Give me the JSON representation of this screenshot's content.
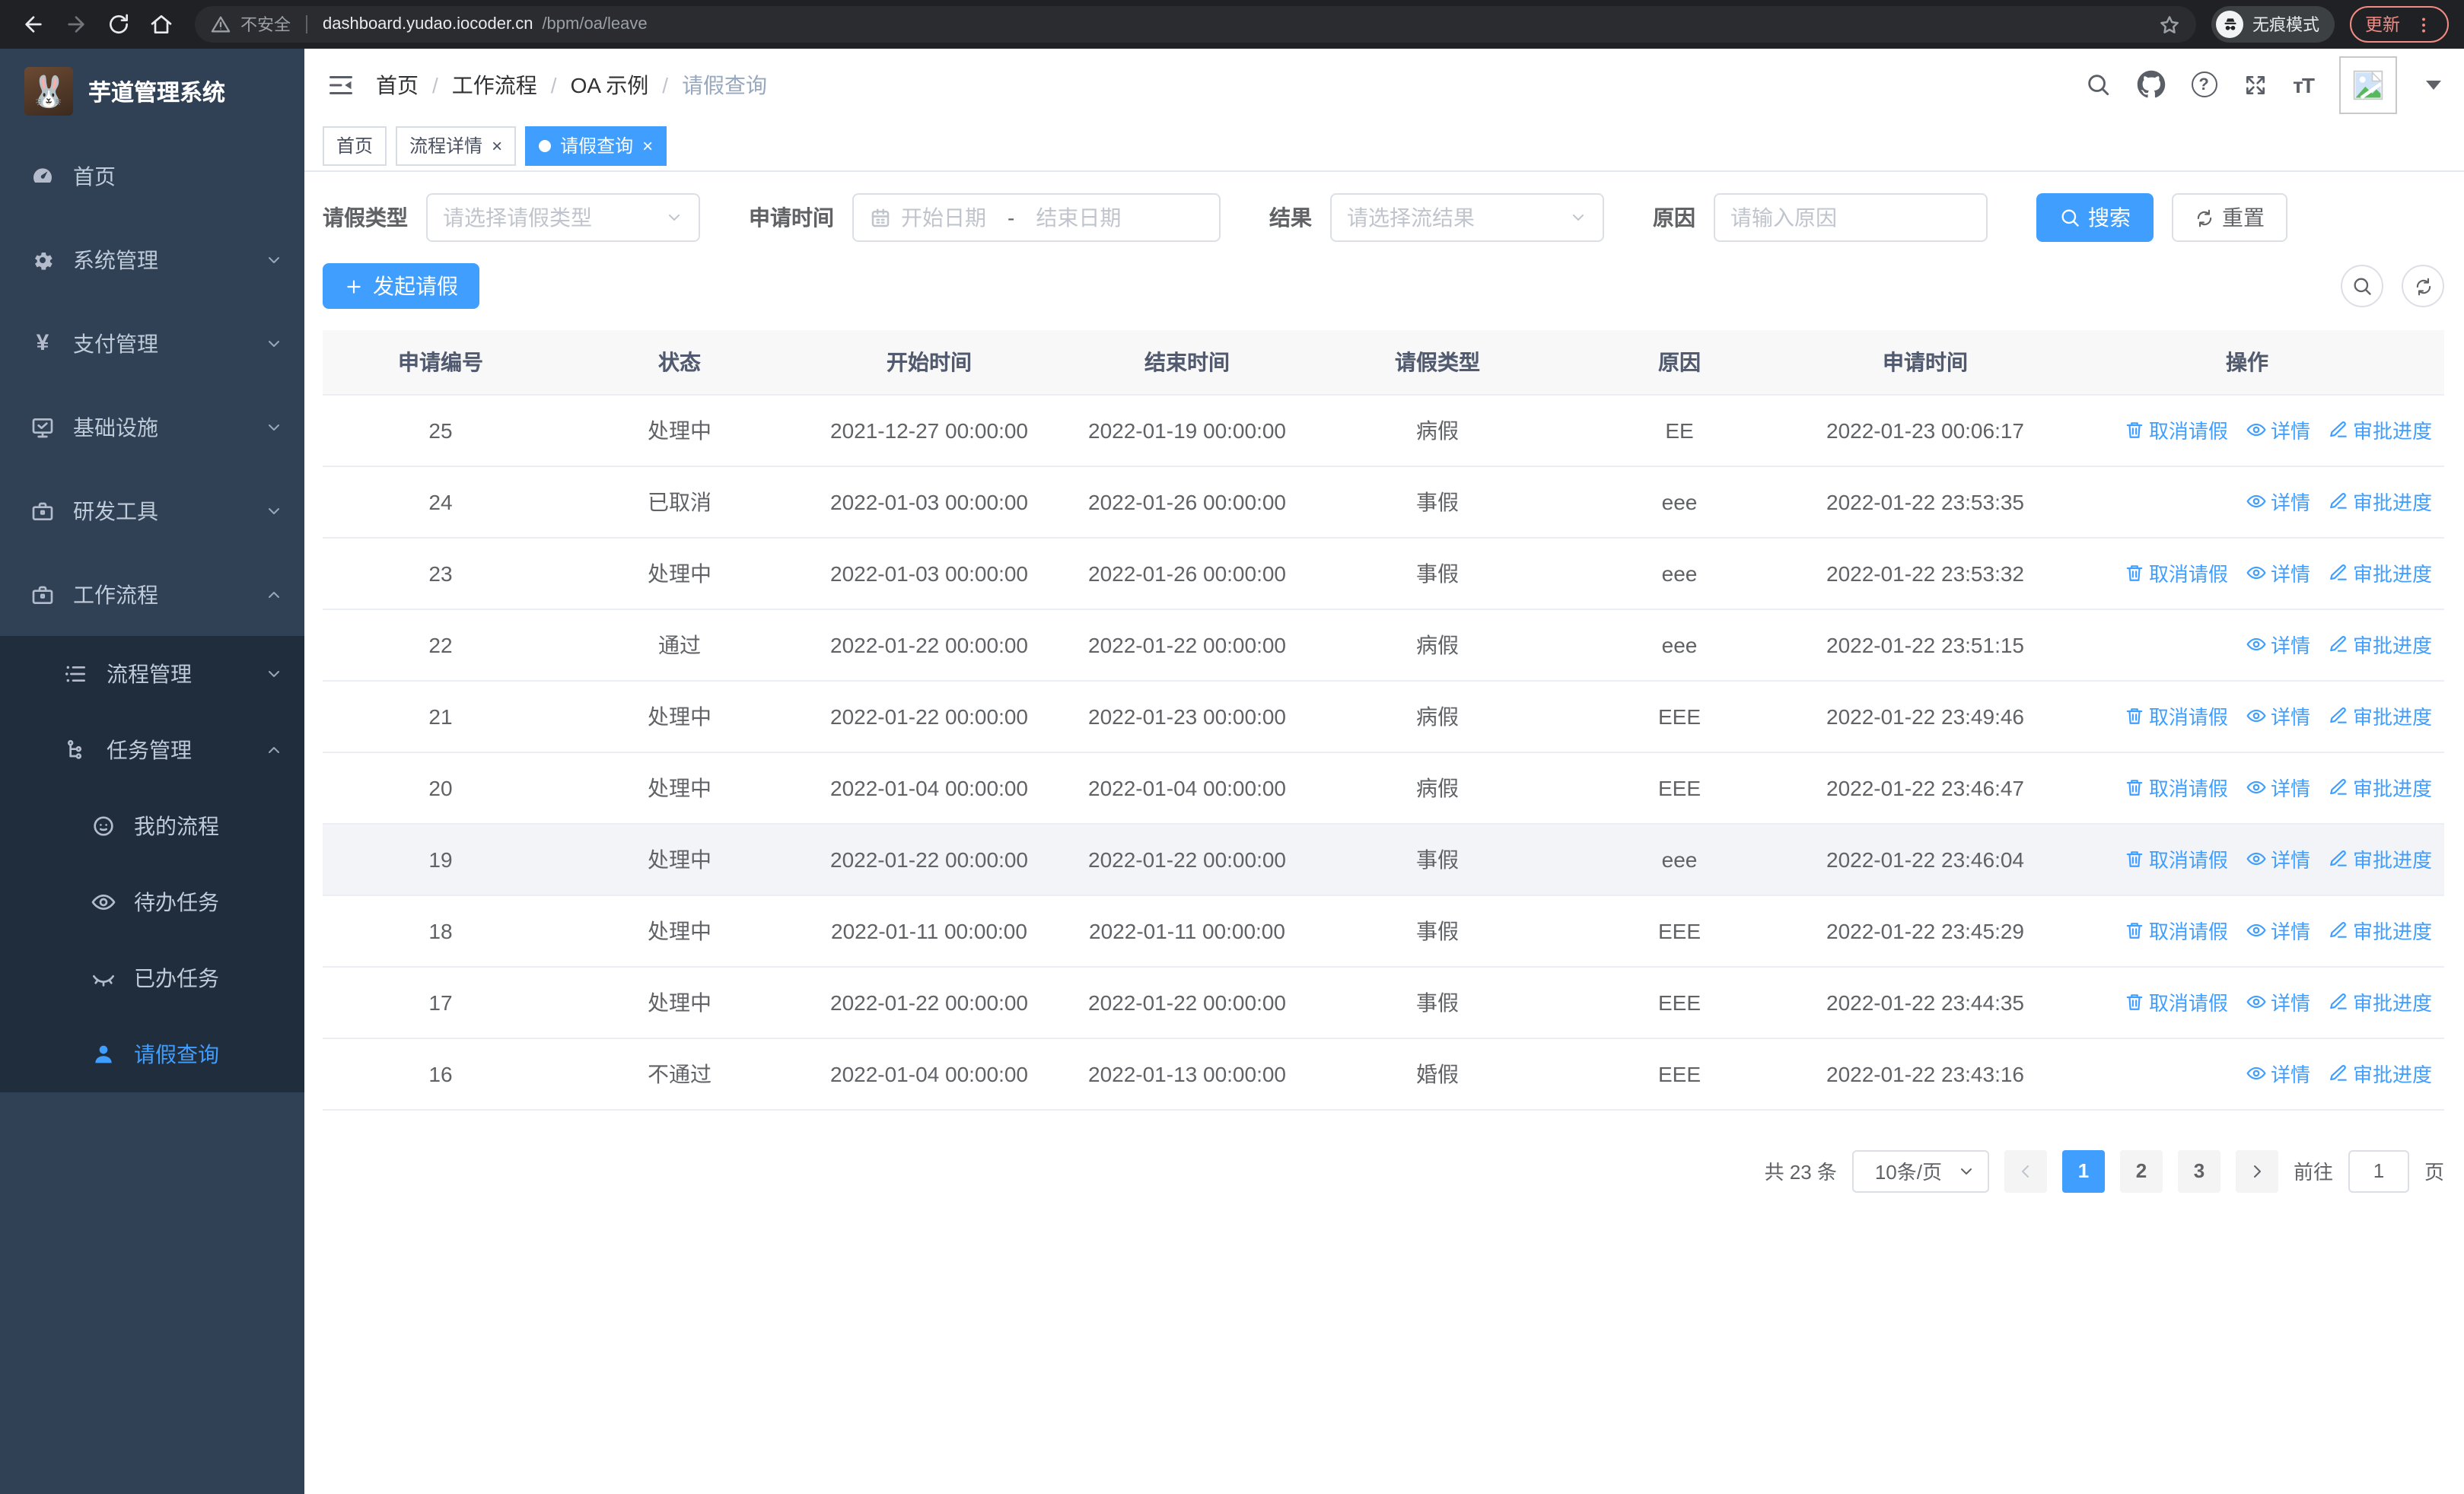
{
  "browser": {
    "security_label": "不安全",
    "url_host": "dashboard.yudao.iocoder.cn",
    "url_path": "/bpm/oa/leave",
    "incognito_label": "无痕模式",
    "update_label": "更新"
  },
  "sidebar": {
    "title": "芋道管理系统",
    "logo_emoji": "🐰",
    "menu": [
      {
        "label": "首页",
        "icon": "gauge"
      },
      {
        "label": "系统管理",
        "icon": "gear",
        "expandable": true
      },
      {
        "label": "支付管理",
        "icon": "yen",
        "expandable": true
      },
      {
        "label": "基础设施",
        "icon": "monitor",
        "expandable": true
      },
      {
        "label": "研发工具",
        "icon": "briefcase",
        "expandable": true
      },
      {
        "label": "工作流程",
        "icon": "briefcase",
        "expandable": true,
        "expanded": true,
        "children": [
          {
            "label": "流程管理",
            "icon": "list",
            "expandable": true
          },
          {
            "label": "任务管理",
            "icon": "tree",
            "expandable": true,
            "expanded": true,
            "children": [
              {
                "label": "我的流程",
                "icon": "face"
              },
              {
                "label": "待办任务",
                "icon": "eye"
              },
              {
                "label": "已办任务",
                "icon": "eye-closed"
              },
              {
                "label": "请假查询",
                "icon": "user",
                "active": true
              }
            ]
          }
        ]
      }
    ]
  },
  "breadcrumb": [
    "首页",
    "工作流程",
    "OA 示例",
    "请假查询"
  ],
  "tabs": [
    {
      "label": "首页",
      "closable": false,
      "active": false
    },
    {
      "label": "流程详情",
      "closable": true,
      "active": false
    },
    {
      "label": "请假查询",
      "closable": true,
      "active": true
    }
  ],
  "filters": {
    "leave_type_label": "请假类型",
    "leave_type_placeholder": "请选择请假类型",
    "apply_time_label": "申请时间",
    "start_date_placeholder": "开始日期",
    "date_separator": "-",
    "end_date_placeholder": "结束日期",
    "result_label": "结果",
    "result_placeholder": "请选择流结果",
    "reason_label": "原因",
    "reason_placeholder": "请输入原因",
    "search_label": "搜索",
    "reset_label": "重置"
  },
  "toolbar": {
    "create_label": "发起请假"
  },
  "table": {
    "columns": [
      "申请编号",
      "状态",
      "开始时间",
      "结束时间",
      "请假类型",
      "原因",
      "申请时间",
      "操作"
    ],
    "action_labels": {
      "cancel": "取消请假",
      "detail": "详情",
      "progress": "审批进度"
    },
    "rows": [
      {
        "id": "25",
        "status": "处理中",
        "start": "2021-12-27 00:00:00",
        "end": "2022-01-19 00:00:00",
        "type": "病假",
        "reason": "EE",
        "apply": "2022-01-23 00:06:17",
        "actions": [
          "cancel",
          "detail",
          "progress"
        ],
        "highlight": false
      },
      {
        "id": "24",
        "status": "已取消",
        "start": "2022-01-03 00:00:00",
        "end": "2022-01-26 00:00:00",
        "type": "事假",
        "reason": "eee",
        "apply": "2022-01-22 23:53:35",
        "actions": [
          "detail",
          "progress"
        ],
        "highlight": false
      },
      {
        "id": "23",
        "status": "处理中",
        "start": "2022-01-03 00:00:00",
        "end": "2022-01-26 00:00:00",
        "type": "事假",
        "reason": "eee",
        "apply": "2022-01-22 23:53:32",
        "actions": [
          "cancel",
          "detail",
          "progress"
        ],
        "highlight": false
      },
      {
        "id": "22",
        "status": "通过",
        "start": "2022-01-22 00:00:00",
        "end": "2022-01-22 00:00:00",
        "type": "病假",
        "reason": "eee",
        "apply": "2022-01-22 23:51:15",
        "actions": [
          "detail",
          "progress"
        ],
        "highlight": false
      },
      {
        "id": "21",
        "status": "处理中",
        "start": "2022-01-22 00:00:00",
        "end": "2022-01-23 00:00:00",
        "type": "病假",
        "reason": "EEE",
        "apply": "2022-01-22 23:49:46",
        "actions": [
          "cancel",
          "detail",
          "progress"
        ],
        "highlight": false
      },
      {
        "id": "20",
        "status": "处理中",
        "start": "2022-01-04 00:00:00",
        "end": "2022-01-04 00:00:00",
        "type": "病假",
        "reason": "EEE",
        "apply": "2022-01-22 23:46:47",
        "actions": [
          "cancel",
          "detail",
          "progress"
        ],
        "highlight": false
      },
      {
        "id": "19",
        "status": "处理中",
        "start": "2022-01-22 00:00:00",
        "end": "2022-01-22 00:00:00",
        "type": "事假",
        "reason": "eee",
        "apply": "2022-01-22 23:46:04",
        "actions": [
          "cancel",
          "detail",
          "progress"
        ],
        "highlight": true
      },
      {
        "id": "18",
        "status": "处理中",
        "start": "2022-01-11 00:00:00",
        "end": "2022-01-11 00:00:00",
        "type": "事假",
        "reason": "EEE",
        "apply": "2022-01-22 23:45:29",
        "actions": [
          "cancel",
          "detail",
          "progress"
        ],
        "highlight": false
      },
      {
        "id": "17",
        "status": "处理中",
        "start": "2022-01-22 00:00:00",
        "end": "2022-01-22 00:00:00",
        "type": "事假",
        "reason": "EEE",
        "apply": "2022-01-22 23:44:35",
        "actions": [
          "cancel",
          "detail",
          "progress"
        ],
        "highlight": false
      },
      {
        "id": "16",
        "status": "不通过",
        "start": "2022-01-04 00:00:00",
        "end": "2022-01-13 00:00:00",
        "type": "婚假",
        "reason": "EEE",
        "apply": "2022-01-22 23:43:16",
        "actions": [
          "detail",
          "progress"
        ],
        "highlight": false
      }
    ]
  },
  "pagination": {
    "total_text": "共 23 条",
    "page_size": "10条/页",
    "pages": [
      "1",
      "2",
      "3"
    ],
    "active_page": "1",
    "goto_label": "前往",
    "goto_value": "1",
    "page_suffix": "页"
  },
  "colors": {
    "accent": "#409eff",
    "sidebar": "#304156",
    "submenu": "#1f2d3d",
    "update": "#f28b82"
  }
}
